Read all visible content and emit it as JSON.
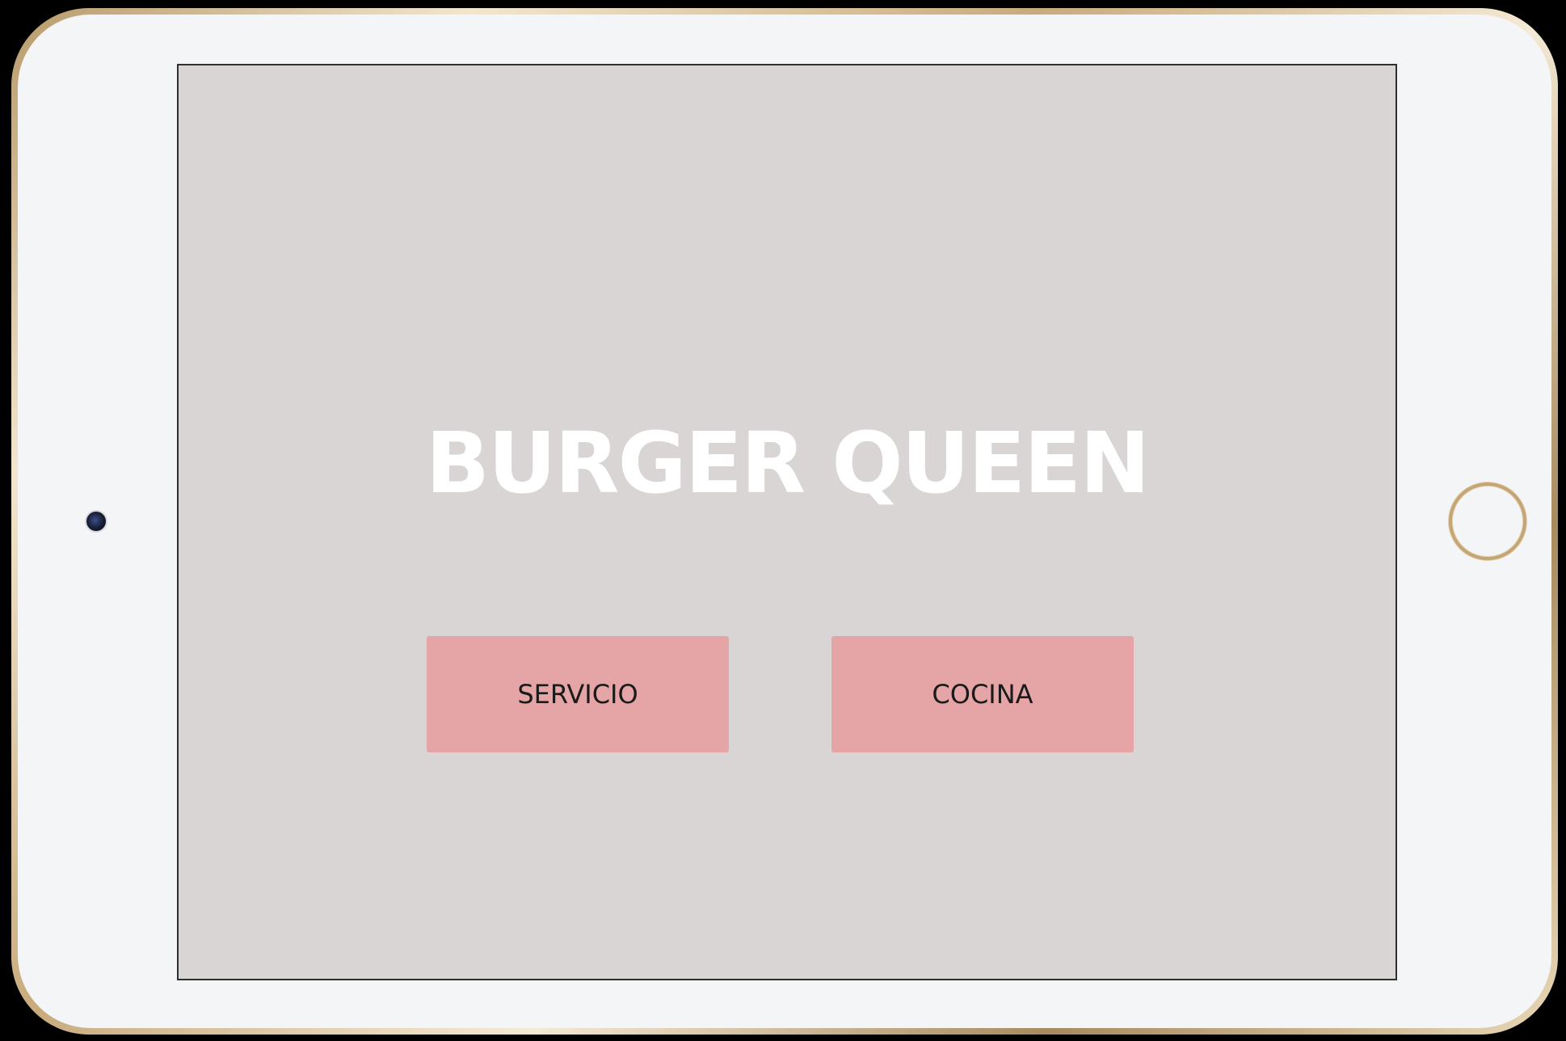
{
  "app": {
    "title": "BURGER QUEEN"
  },
  "actions": {
    "servicio_label": "SERVICIO",
    "cocina_label": "COCINA"
  },
  "colors": {
    "screen_background": "#d8d5d4",
    "button_background": "#e5a5a6",
    "title_color": "#ffffff",
    "button_text": "#1a1a1a",
    "device_bezel": "#f4f5f7",
    "device_rim": "#c4a676"
  },
  "device": {
    "camera_icon": "front-camera-icon",
    "home_button_icon": "home-button-icon"
  }
}
